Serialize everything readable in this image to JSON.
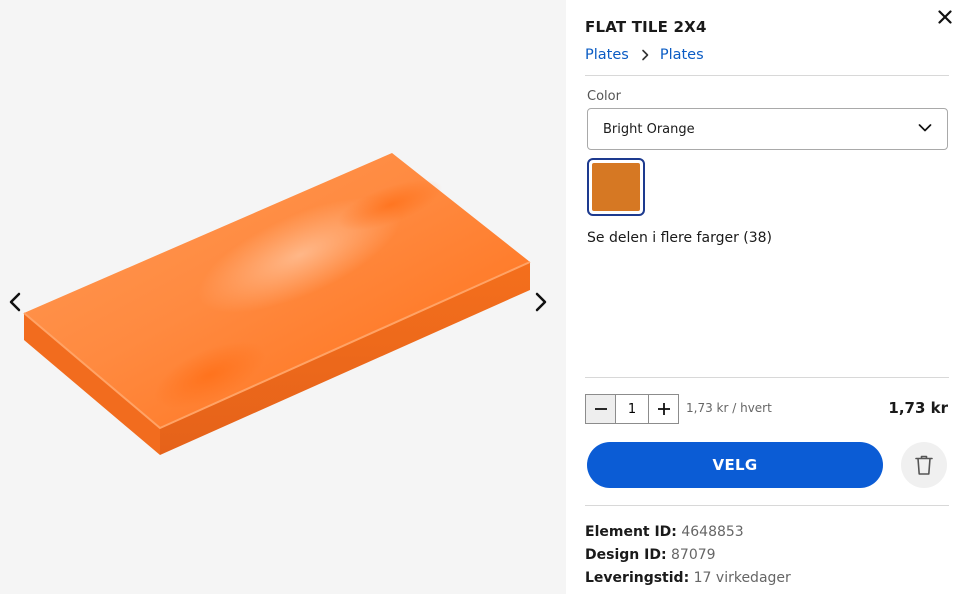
{
  "product": {
    "title": "FLAT TILE 2X4",
    "breadcrumb": [
      "Plates",
      "Plates"
    ]
  },
  "gallery": {
    "prev_icon": "chevron-left-icon",
    "next_icon": "chevron-right-icon",
    "image_subject": "orange-flat-tile-2x4",
    "tile_color": "#ff7a2a"
  },
  "color": {
    "label": "Color",
    "selected": "Bright Orange",
    "swatch_color": "#d67823",
    "more_colors_text": "Se delen i flere farger (38)"
  },
  "purchase": {
    "quantity": "1",
    "unit_price": "1,73 kr / hvert",
    "total_price": "1,73 kr",
    "select_label": "VELG",
    "accent_color": "#0b5cd5"
  },
  "meta": {
    "element_id_label": "Element ID:",
    "element_id": "4648853",
    "design_id_label": "Design ID:",
    "design_id": "87079",
    "delivery_label": "Leveringstid:",
    "delivery_time": "17 virkedager"
  }
}
